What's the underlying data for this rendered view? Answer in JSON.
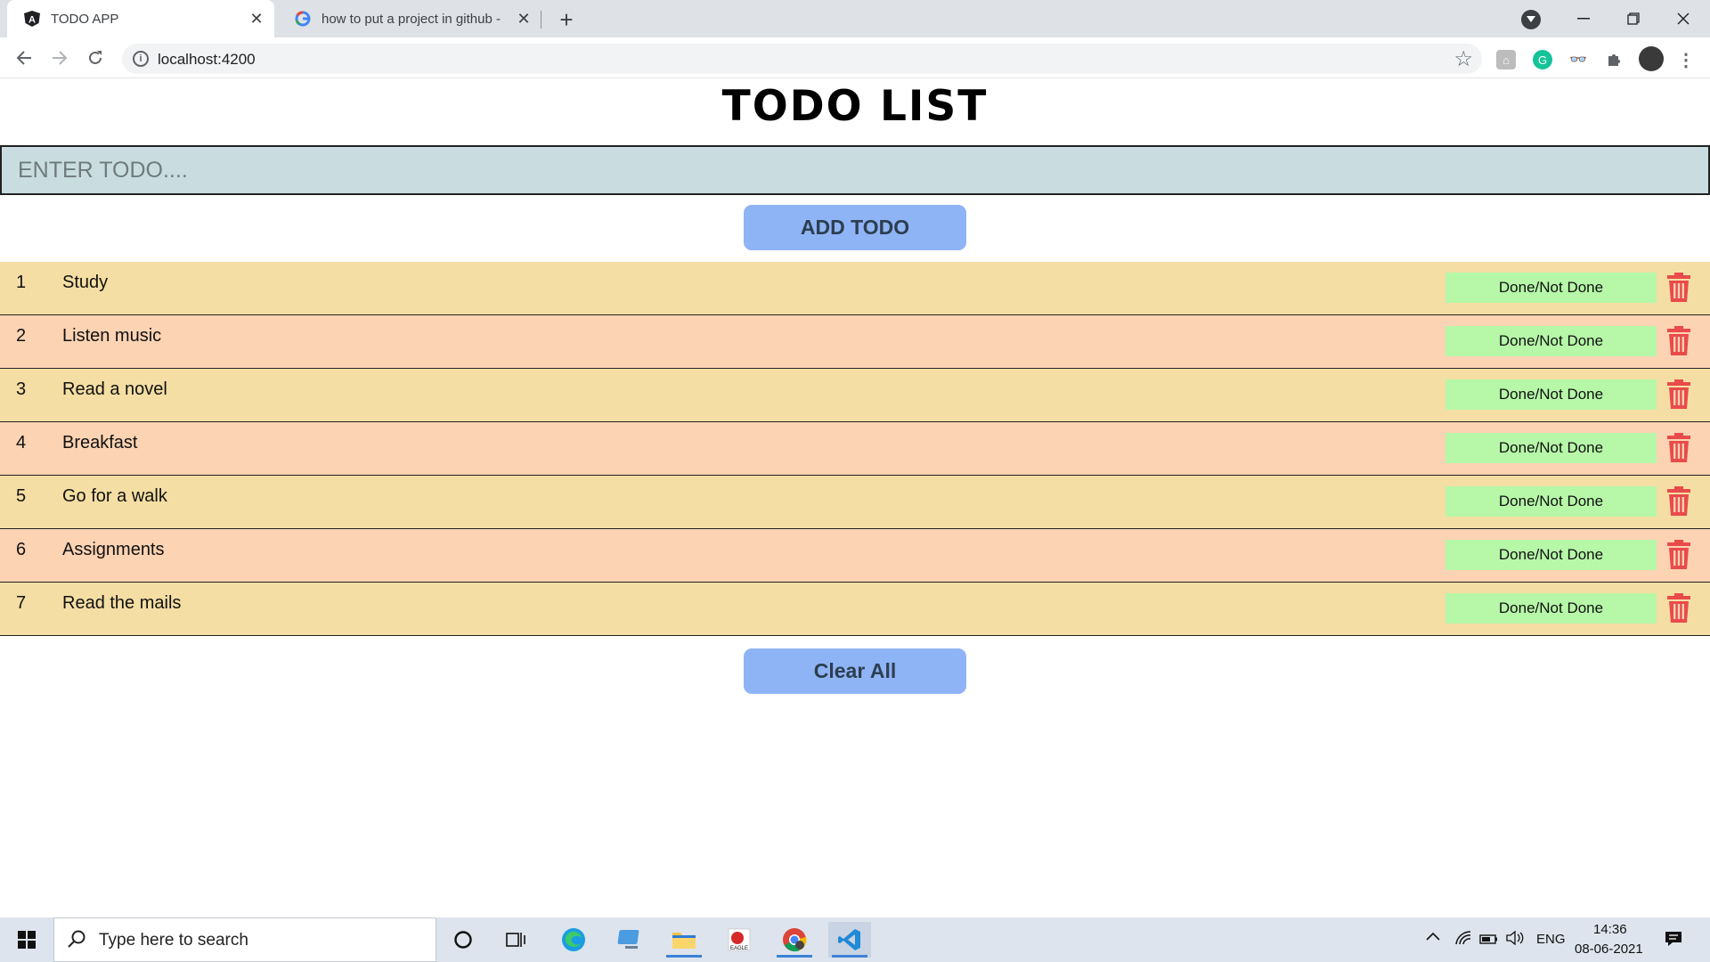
{
  "browser": {
    "tabs": [
      {
        "title": "TODO APP",
        "favicon": "angular-icon"
      },
      {
        "title": "how to put a project in github - ",
        "favicon": "google-icon"
      }
    ],
    "url": "localhost:4200",
    "new_tab_symbol": "+"
  },
  "app": {
    "title": "TODO LIST",
    "input_placeholder": "ENTER TODO....",
    "add_button": "ADD TODO",
    "clear_button": "Clear All",
    "done_label": "Done/Not Done",
    "todos": [
      {
        "index": "1",
        "text": "Study"
      },
      {
        "index": "2",
        "text": "Listen music"
      },
      {
        "index": "3",
        "text": "Read a novel"
      },
      {
        "index": "4",
        "text": "Breakfast"
      },
      {
        "index": "5",
        "text": "Go for a walk"
      },
      {
        "index": "6",
        "text": "Assignments"
      },
      {
        "index": "7",
        "text": "Read the mails"
      }
    ]
  },
  "taskbar": {
    "search_placeholder": "Type here to search",
    "language": "ENG",
    "time": "14:36",
    "date": "08-06-2021"
  },
  "colors": {
    "row_even": "#f5dea3",
    "row_odd": "#fcd3b3",
    "button": "#8fb4f5",
    "done_button": "#b6f7a8",
    "trash": "#e94b4b",
    "input_bg": "#c9dde0"
  }
}
